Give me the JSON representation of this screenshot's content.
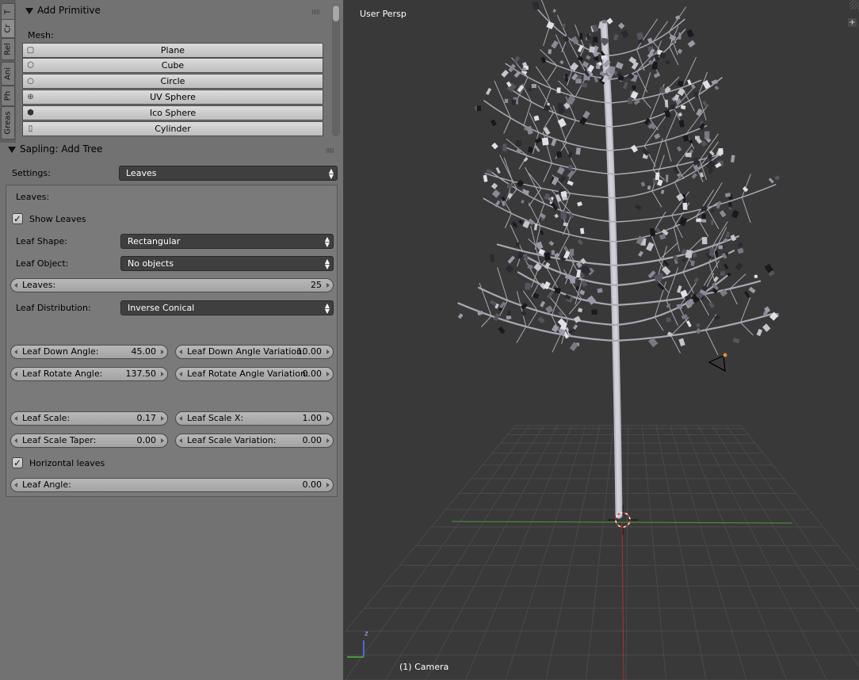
{
  "tabs": [
    "T",
    "Cr",
    "Rel",
    "Ani",
    "Ph",
    "Greas"
  ],
  "add_primitive": {
    "title": "Add Primitive",
    "mesh_label": "Mesh:",
    "items": [
      {
        "label": "Plane",
        "icon": "plane-icon"
      },
      {
        "label": "Cube",
        "icon": "cube-icon"
      },
      {
        "label": "Circle",
        "icon": "circle-icon"
      },
      {
        "label": "UV Sphere",
        "icon": "uv-sphere-icon"
      },
      {
        "label": "Ico Sphere",
        "icon": "ico-sphere-icon"
      },
      {
        "label": "Cylinder",
        "icon": "cylinder-icon"
      }
    ]
  },
  "sapling": {
    "title": "Sapling: Add Tree",
    "settings_label": "Settings:",
    "settings_value": "Leaves",
    "leaves_section": "Leaves:",
    "show_leaves": {
      "label": "Show Leaves",
      "checked": true
    },
    "leaf_shape": {
      "label": "Leaf Shape:",
      "value": "Rectangular"
    },
    "leaf_object": {
      "label": "Leaf Object:",
      "value": "No objects"
    },
    "leaves": {
      "label": "Leaves:",
      "value": "25"
    },
    "leaf_distribution": {
      "label": "Leaf Distribution:",
      "value": "Inverse Conical"
    },
    "leaf_down_angle": {
      "label": "Leaf Down Angle:",
      "value": "45.00"
    },
    "leaf_down_angle_variation": {
      "label": "Leaf Down Angle Variation:",
      "value": "10.00"
    },
    "leaf_rotate_angle": {
      "label": "Leaf Rotate Angle:",
      "value": "137.50"
    },
    "leaf_rotate_angle_variation": {
      "label": "Leaf Rotate Angle Variation:",
      "value": "0.00"
    },
    "leaf_scale": {
      "label": "Leaf Scale:",
      "value": "0.17"
    },
    "leaf_scale_x": {
      "label": "Leaf Scale X:",
      "value": "1.00"
    },
    "leaf_scale_taper": {
      "label": "Leaf Scale Taper:",
      "value": "0.00"
    },
    "leaf_scale_variation": {
      "label": "Leaf Scale Variation:",
      "value": "0.00"
    },
    "horizontal_leaves": {
      "label": "Horizontal leaves",
      "checked": true
    },
    "leaf_angle": {
      "label": "Leaf Angle:",
      "value": "0.00"
    }
  },
  "viewport": {
    "view_name": "User Persp",
    "object_info": "(1) Camera",
    "axis_z": "z"
  },
  "colors": {
    "panel_bg": "#727272",
    "viewport_bg": "#393939",
    "dropdown_bg": "#3f3f3f",
    "x_axis": "#b03030",
    "y_axis": "#4a9a3a"
  }
}
